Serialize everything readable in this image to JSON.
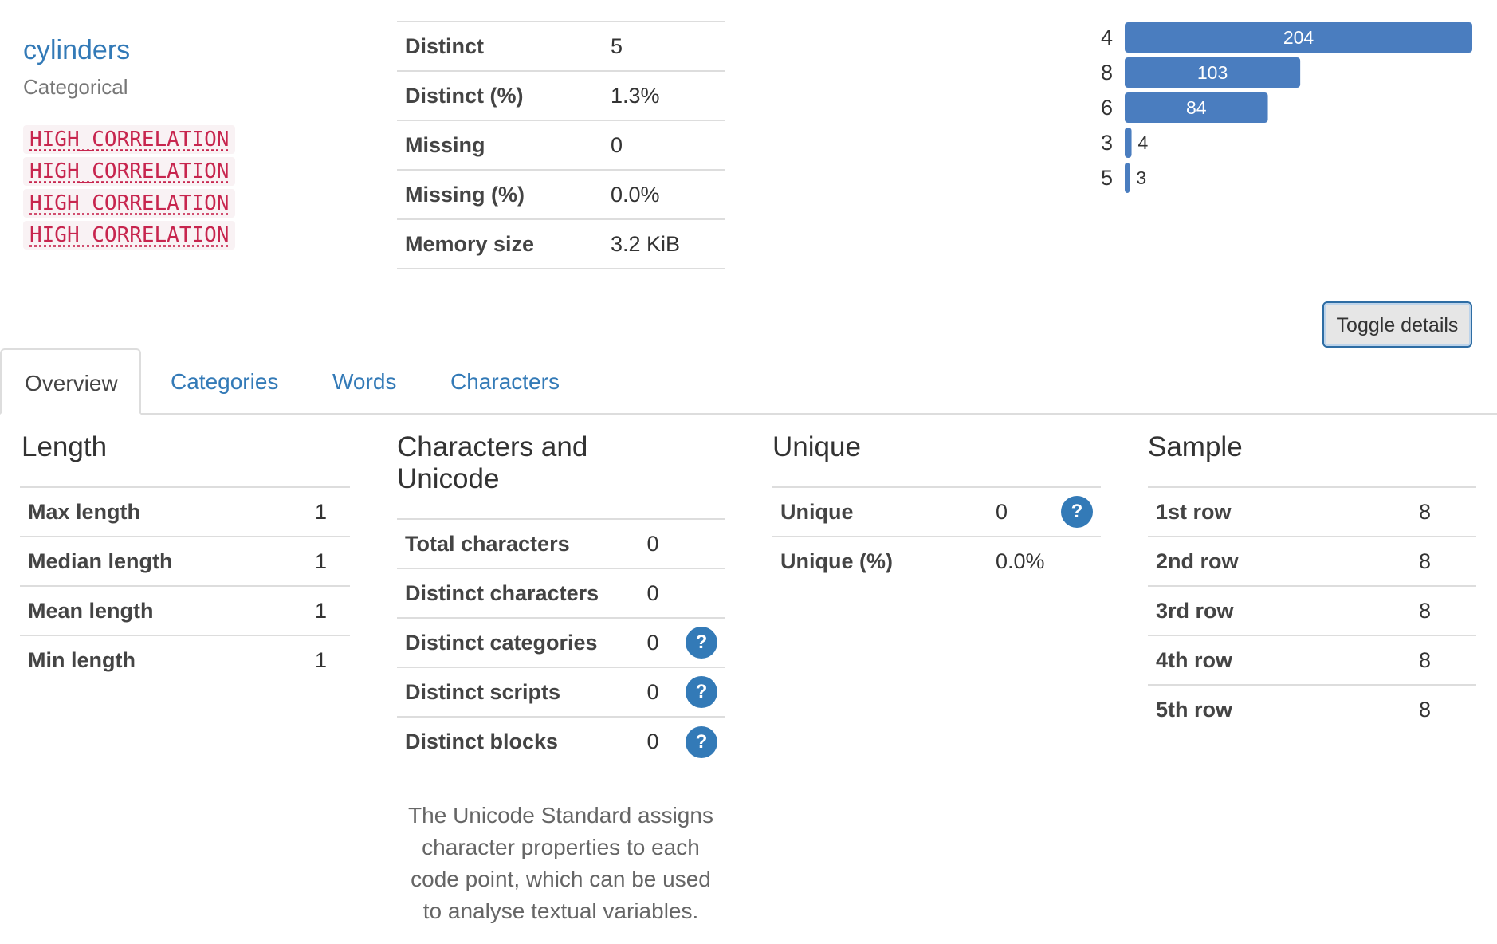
{
  "variable": {
    "name": "cylinders",
    "type": "Categorical",
    "warnings": [
      "HIGH_CORRELATION",
      "HIGH_CORRELATION",
      "HIGH_CORRELATION",
      "HIGH_CORRELATION"
    ]
  },
  "summary": [
    {
      "label": "Distinct",
      "value": "5"
    },
    {
      "label": "Distinct (%)",
      "value": "1.3%"
    },
    {
      "label": "Missing",
      "value": "0"
    },
    {
      "label": "Missing (%)",
      "value": "0.0%"
    },
    {
      "label": "Memory size",
      "value": "3.2 KiB"
    }
  ],
  "chart_data": {
    "type": "bar",
    "orientation": "horizontal",
    "categories": [
      "4",
      "8",
      "6",
      "3",
      "5"
    ],
    "values": [
      204,
      103,
      84,
      4,
      3
    ],
    "bar_color": "#4a7dbf"
  },
  "toggle_label": "Toggle details",
  "tabs": [
    "Overview",
    "Categories",
    "Words",
    "Characters"
  ],
  "length": {
    "title": "Length",
    "rows": [
      {
        "label": "Max length",
        "value": "1"
      },
      {
        "label": "Median length",
        "value": "1"
      },
      {
        "label": "Mean length",
        "value": "1"
      },
      {
        "label": "Min length",
        "value": "1"
      }
    ]
  },
  "unicode": {
    "title_line1": "Characters and",
    "title_line2": "Unicode",
    "rows": [
      {
        "label": "Total characters",
        "value": "0"
      },
      {
        "label": "Distinct characters",
        "value": "0"
      },
      {
        "label": "Distinct categories",
        "value": "0"
      },
      {
        "label": "Distinct scripts",
        "value": "0"
      },
      {
        "label": "Distinct blocks",
        "value": "0"
      }
    ],
    "description": "The Unicode Standard assigns character properties to each code point, which can be used to analyse textual variables."
  },
  "unique": {
    "title": "Unique",
    "rows": [
      {
        "label": "Unique",
        "value": "0"
      },
      {
        "label": "Unique (%)",
        "value": "0.0%"
      }
    ]
  },
  "sample": {
    "title": "Sample",
    "rows": [
      {
        "label": "1st row",
        "value": "8"
      },
      {
        "label": "2nd row",
        "value": "8"
      },
      {
        "label": "3rd row",
        "value": "8"
      },
      {
        "label": "4th row",
        "value": "8"
      },
      {
        "label": "5th row",
        "value": "8"
      }
    ]
  },
  "help_icon": "?",
  "accent": "#337ab7"
}
